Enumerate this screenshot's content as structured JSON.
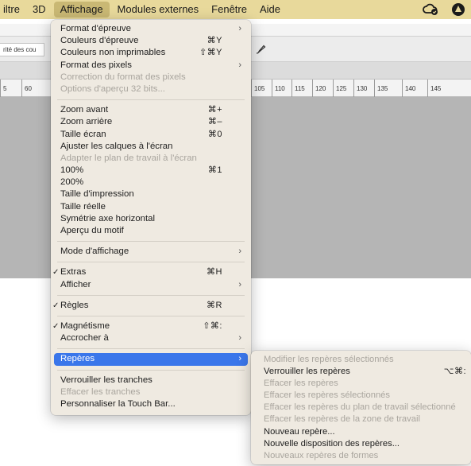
{
  "menubar": {
    "items": [
      "iltre",
      "3D",
      "Affichage",
      "Modules externes",
      "Fenêtre",
      "Aide"
    ]
  },
  "options": {
    "field_text": "rité des cou"
  },
  "ruler": {
    "ticks": [
      "5",
      "60",
      "105",
      "110",
      "115",
      "120",
      "125",
      "130",
      "135",
      "140",
      "145"
    ]
  },
  "menu": {
    "items": [
      {
        "label": "Format d'épreuve",
        "shortcut": "",
        "submenu": true,
        "disabled": false,
        "checked": false
      },
      {
        "label": "Couleurs d'épreuve",
        "shortcut": "⌘Y",
        "submenu": false,
        "disabled": false,
        "checked": false
      },
      {
        "label": "Couleurs non imprimables",
        "shortcut": "⇧⌘Y",
        "submenu": false,
        "disabled": false,
        "checked": false
      },
      {
        "label": "Format des pixels",
        "shortcut": "",
        "submenu": true,
        "disabled": false,
        "checked": false
      },
      {
        "label": "Correction du format des pixels",
        "shortcut": "",
        "submenu": false,
        "disabled": true,
        "checked": false
      },
      {
        "label": "Options d'aperçu 32 bits...",
        "shortcut": "",
        "submenu": false,
        "disabled": true,
        "checked": false
      },
      {
        "sep": true
      },
      {
        "label": "Zoom avant",
        "shortcut": "⌘+",
        "submenu": false,
        "disabled": false,
        "checked": false
      },
      {
        "label": "Zoom arrière",
        "shortcut": "⌘–",
        "submenu": false,
        "disabled": false,
        "checked": false
      },
      {
        "label": "Taille écran",
        "shortcut": "⌘0",
        "submenu": false,
        "disabled": false,
        "checked": false
      },
      {
        "label": "Ajuster les calques à l'écran",
        "shortcut": "",
        "submenu": false,
        "disabled": false,
        "checked": false
      },
      {
        "label": "Adapter le plan de travail à l'écran",
        "shortcut": "",
        "submenu": false,
        "disabled": true,
        "checked": false
      },
      {
        "label": "100%",
        "shortcut": "⌘1",
        "submenu": false,
        "disabled": false,
        "checked": false
      },
      {
        "label": "200%",
        "shortcut": "",
        "submenu": false,
        "disabled": false,
        "checked": false
      },
      {
        "label": "Taille d'impression",
        "shortcut": "",
        "submenu": false,
        "disabled": false,
        "checked": false
      },
      {
        "label": "Taille réelle",
        "shortcut": "",
        "submenu": false,
        "disabled": false,
        "checked": false
      },
      {
        "label": "Symétrie axe horizontal",
        "shortcut": "",
        "submenu": false,
        "disabled": false,
        "checked": false
      },
      {
        "label": "Aperçu du motif",
        "shortcut": "",
        "submenu": false,
        "disabled": false,
        "checked": false
      },
      {
        "sep": true
      },
      {
        "label": "Mode d'affichage",
        "shortcut": "",
        "submenu": true,
        "disabled": false,
        "checked": false
      },
      {
        "sep": true
      },
      {
        "label": "Extras",
        "shortcut": "⌘H",
        "submenu": false,
        "disabled": false,
        "checked": true
      },
      {
        "label": "Afficher",
        "shortcut": "",
        "submenu": true,
        "disabled": false,
        "checked": false
      },
      {
        "sep": true
      },
      {
        "label": "Règles",
        "shortcut": "⌘R",
        "submenu": false,
        "disabled": false,
        "checked": true
      },
      {
        "sep": true
      },
      {
        "label": "Magnétisme",
        "shortcut": "⇧⌘:",
        "submenu": false,
        "disabled": false,
        "checked": true
      },
      {
        "label": "Accrocher à",
        "shortcut": "",
        "submenu": true,
        "disabled": false,
        "checked": false
      },
      {
        "sep": true
      },
      {
        "label": "Repères",
        "shortcut": "",
        "submenu": true,
        "disabled": false,
        "checked": false,
        "highlighted": true
      },
      {
        "sep": true
      },
      {
        "label": "Verrouiller les tranches",
        "shortcut": "",
        "submenu": false,
        "disabled": false,
        "checked": false
      },
      {
        "label": "Effacer les tranches",
        "shortcut": "",
        "submenu": false,
        "disabled": true,
        "checked": false
      },
      {
        "label": "Personnaliser la Touch Bar...",
        "shortcut": "",
        "submenu": false,
        "disabled": false,
        "checked": false
      }
    ]
  },
  "submenu": {
    "items": [
      {
        "label": "Modifier les repères sélectionnés",
        "shortcut": "",
        "disabled": true
      },
      {
        "label": "Verrouiller les repères",
        "shortcut": "⌥⌘:",
        "disabled": false
      },
      {
        "label": "Effacer les repères",
        "shortcut": "",
        "disabled": true
      },
      {
        "label": "Effacer les repères sélectionnés",
        "shortcut": "",
        "disabled": true
      },
      {
        "label": "Effacer les repères du plan de travail sélectionné",
        "shortcut": "",
        "disabled": true
      },
      {
        "label": "Effacer les repères de la zone de travail",
        "shortcut": "",
        "disabled": true
      },
      {
        "label": "Nouveau repère...",
        "shortcut": "",
        "disabled": false
      },
      {
        "label": "Nouvelle disposition des repères...",
        "shortcut": "",
        "disabled": false
      },
      {
        "label": "Nouveaux repères de formes",
        "shortcut": "",
        "disabled": true
      }
    ]
  }
}
